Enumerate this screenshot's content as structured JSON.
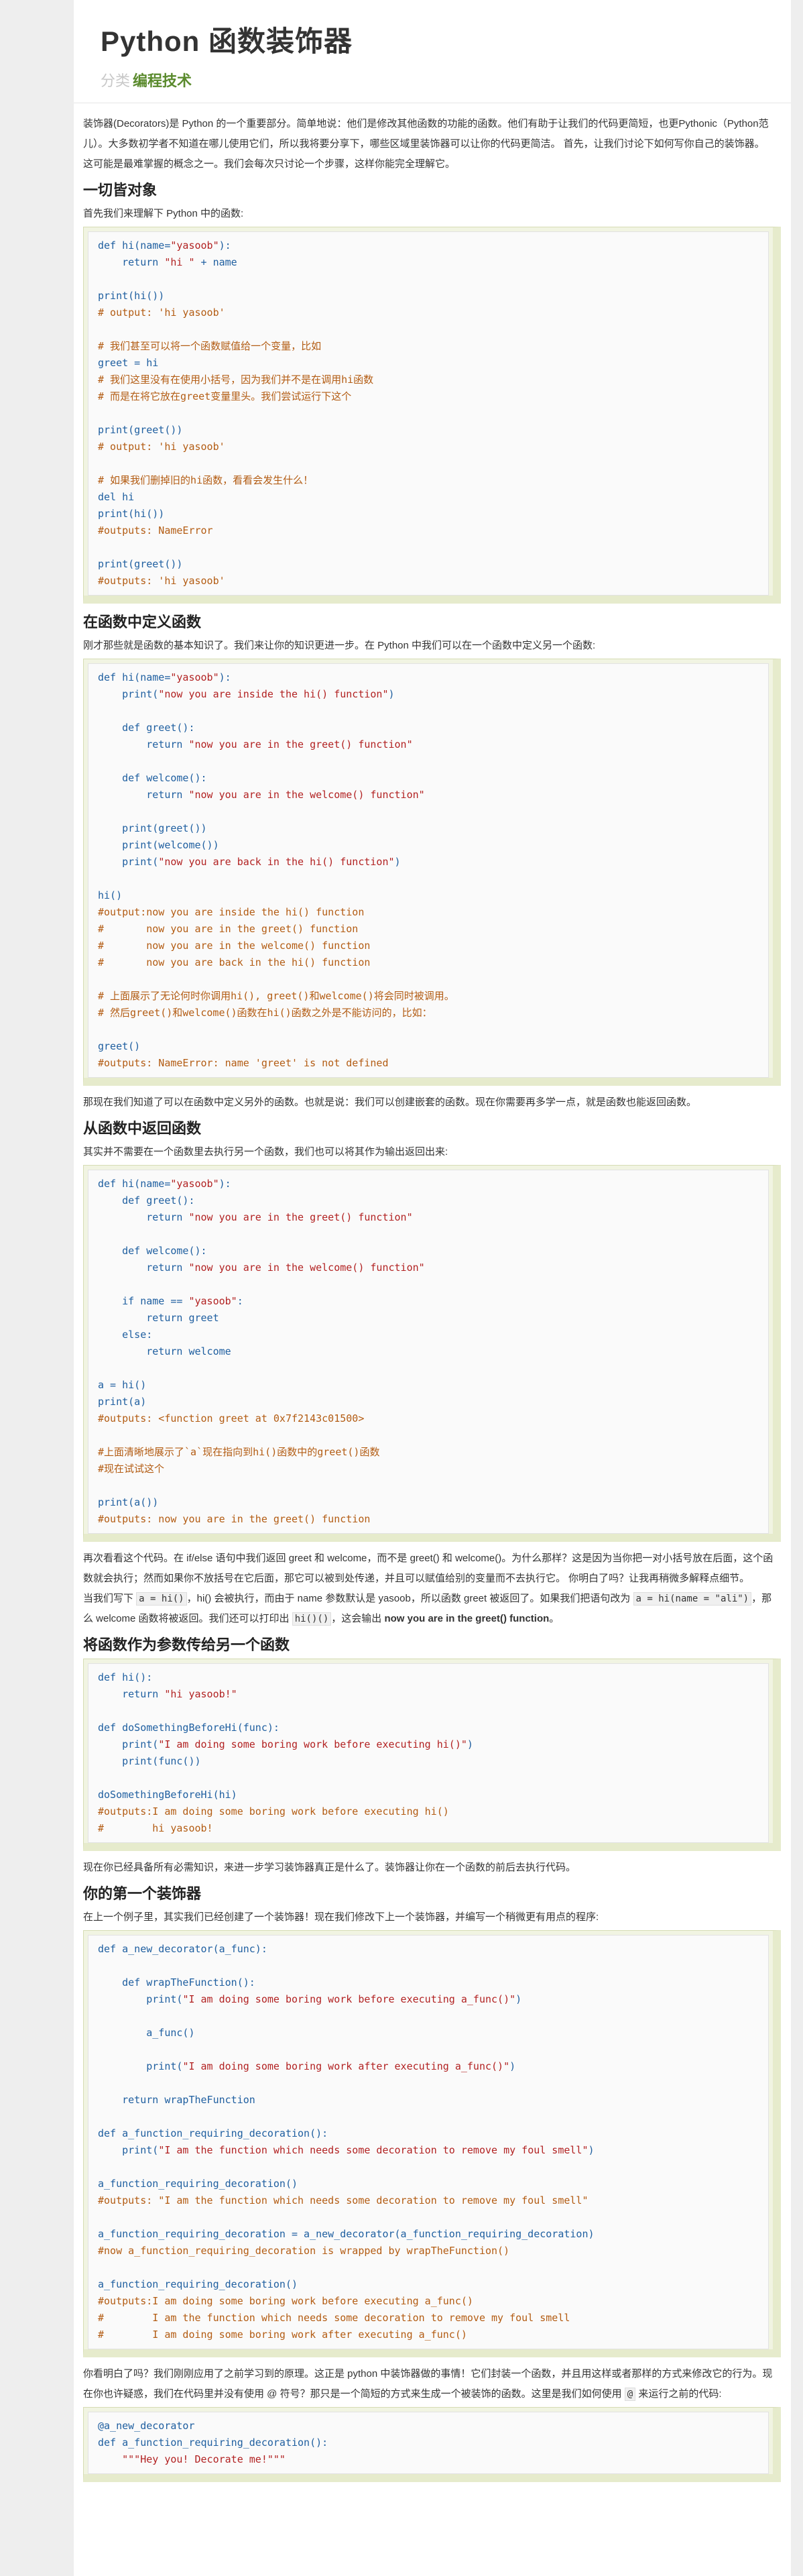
{
  "header": {
    "title": "Python 函数装饰器",
    "category_label": "分类",
    "category_link": "编程技术"
  },
  "intro": [
    "装饰器(Decorators)是 Python 的一个重要部分。简单地说：他们是修改其他函数的功能的函数。他们有助于让我们的代码更简短，也更Pythonic（Python范儿）。大多数初学者不知道在哪儿使用它们，所以我将要分享下，哪些区域里装饰器可以让你的代码更简洁。 首先，让我们讨论下如何写你自己的装饰器。",
    "这可能是最难掌握的概念之一。我们会每次只讨论一个步骤，这样你能完全理解它。"
  ],
  "sections": {
    "s1": {
      "heading": "一切皆对象",
      "text": "首先我们来理解下 Python 中的函数:"
    },
    "s2": {
      "heading": "在函数中定义函数",
      "text": "刚才那些就是函数的基本知识了。我们来让你的知识更进一步。在 Python 中我们可以在一个函数中定义另一个函数:",
      "after": "那现在我们知道了可以在函数中定义另外的函数。也就是说：我们可以创建嵌套的函数。现在你需要再多学一点，就是函数也能返回函数。"
    },
    "s3": {
      "heading": "从函数中返回函数",
      "text": "其实并不需要在一个函数里去执行另一个函数，我们也可以将其作为输出返回出来:",
      "after1": "再次看看这个代码。在 if/else 语句中我们返回 greet 和 welcome，而不是 greet() 和 welcome()。为什么那样？这是因为当你把一对小括号放在后面，这个函数就会执行；然而如果你不放括号在它后面，那它可以被到处传递，并且可以赋值给别的变量而不去执行它。 你明白了吗？让我再稍微多解释点细节。",
      "after2_a": "当我们写下 ",
      "after2_code1": "a = hi()",
      "after2_b": "，hi() 会被执行，而由于 name 参数默认是 yasoob，所以函数 greet 被返回了。如果我们把语句改为 ",
      "after2_code2": "a = hi(name = \"ali\")",
      "after2_c": "，那么 welcome 函数将被返回。我们还可以打印出 ",
      "after2_code3": "hi()()",
      "after2_d": "，这会输出 ",
      "after2_bold": "now you are in the greet() function",
      "after2_e": "。"
    },
    "s4": {
      "heading": "将函数作为参数传给另一个函数",
      "after": "现在你已经具备所有必需知识，来进一步学习装饰器真正是什么了。装饰器让你在一个函数的前后去执行代码。"
    },
    "s5": {
      "heading": "你的第一个装饰器",
      "text": "在上一个例子里，其实我们已经创建了一个装饰器！现在我们修改下上一个装饰器，并编写一个稍微更有用点的程序:",
      "after_a": "你看明白了吗？我们刚刚应用了之前学习到的原理。这正是 python 中装饰器做的事情！它们封装一个函数，并且用这样或者那样的方式来修改它的行为。现在你也许疑惑，我们在代码里并没有使用 @ 符号？那只是一个简短的方式来生成一个被装饰的函数。这里是我们如何使用 ",
      "after_code": "@",
      "after_b": " 来运行之前的代码:"
    }
  },
  "code_blocks": {
    "c1": [
      [
        [
          "k",
          "def hi(name="
        ],
        [
          "s",
          "\"yasoob\""
        ],
        [
          "k",
          "):"
        ]
      ],
      [
        [
          "k",
          "    return "
        ],
        [
          "s",
          "\"hi \""
        ],
        [
          "k",
          " + name"
        ]
      ],
      [
        [
          "k",
          ""
        ]
      ],
      [
        [
          "k",
          "print(hi())"
        ]
      ],
      [
        [
          "c",
          "# output: 'hi yasoob'"
        ]
      ],
      [
        [
          "k",
          ""
        ]
      ],
      [
        [
          "c",
          "# 我们甚至可以将一个函数赋值给一个变量，比如"
        ]
      ],
      [
        [
          "k",
          "greet = hi"
        ]
      ],
      [
        [
          "c",
          "# 我们这里没有在使用小括号，因为我们并不是在调用hi函数"
        ]
      ],
      [
        [
          "c",
          "# 而是在将它放在greet变量里头。我们尝试运行下这个"
        ]
      ],
      [
        [
          "k",
          ""
        ]
      ],
      [
        [
          "k",
          "print(greet())"
        ]
      ],
      [
        [
          "c",
          "# output: 'hi yasoob'"
        ]
      ],
      [
        [
          "k",
          ""
        ]
      ],
      [
        [
          "c",
          "# 如果我们删掉旧的hi函数，看看会发生什么！"
        ]
      ],
      [
        [
          "k",
          "del hi"
        ]
      ],
      [
        [
          "k",
          "print(hi())"
        ]
      ],
      [
        [
          "c",
          "#outputs: NameError"
        ]
      ],
      [
        [
          "k",
          ""
        ]
      ],
      [
        [
          "k",
          "print(greet())"
        ]
      ],
      [
        [
          "c",
          "#outputs: 'hi yasoob'"
        ]
      ]
    ],
    "c2": [
      [
        [
          "k",
          "def hi(name="
        ],
        [
          "s",
          "\"yasoob\""
        ],
        [
          "k",
          "):"
        ]
      ],
      [
        [
          "k",
          "    print("
        ],
        [
          "s",
          "\"now you are inside the hi() function\""
        ],
        [
          "k",
          ")"
        ]
      ],
      [
        [
          "k",
          ""
        ]
      ],
      [
        [
          "k",
          "    def greet():"
        ]
      ],
      [
        [
          "k",
          "        return "
        ],
        [
          "s",
          "\"now you are in the greet() function\""
        ]
      ],
      [
        [
          "k",
          ""
        ]
      ],
      [
        [
          "k",
          "    def welcome():"
        ]
      ],
      [
        [
          "k",
          "        return "
        ],
        [
          "s",
          "\"now you are in the welcome() function\""
        ]
      ],
      [
        [
          "k",
          ""
        ]
      ],
      [
        [
          "k",
          "    print(greet())"
        ]
      ],
      [
        [
          "k",
          "    print(welcome())"
        ]
      ],
      [
        [
          "k",
          "    print("
        ],
        [
          "s",
          "\"now you are back in the hi() function\""
        ],
        [
          "k",
          ")"
        ]
      ],
      [
        [
          "k",
          ""
        ]
      ],
      [
        [
          "k",
          "hi()"
        ]
      ],
      [
        [
          "c",
          "#output:now you are inside the hi() function"
        ]
      ],
      [
        [
          "c",
          "#       now you are in the greet() function"
        ]
      ],
      [
        [
          "c",
          "#       now you are in the welcome() function"
        ]
      ],
      [
        [
          "c",
          "#       now you are back in the hi() function"
        ]
      ],
      [
        [
          "k",
          ""
        ]
      ],
      [
        [
          "c",
          "# 上面展示了无论何时你调用hi(), greet()和welcome()将会同时被调用。"
        ]
      ],
      [
        [
          "c",
          "# 然后greet()和welcome()函数在hi()函数之外是不能访问的，比如："
        ]
      ],
      [
        [
          "k",
          ""
        ]
      ],
      [
        [
          "k",
          "greet()"
        ]
      ],
      [
        [
          "c",
          "#outputs: NameError: name 'greet' is not defined"
        ]
      ]
    ],
    "c3": [
      [
        [
          "k",
          "def hi(name="
        ],
        [
          "s",
          "\"yasoob\""
        ],
        [
          "k",
          "):"
        ]
      ],
      [
        [
          "k",
          "    def greet():"
        ]
      ],
      [
        [
          "k",
          "        return "
        ],
        [
          "s",
          "\"now you are in the greet() function\""
        ]
      ],
      [
        [
          "k",
          ""
        ]
      ],
      [
        [
          "k",
          "    def welcome():"
        ]
      ],
      [
        [
          "k",
          "        return "
        ],
        [
          "s",
          "\"now you are in the welcome() function\""
        ]
      ],
      [
        [
          "k",
          ""
        ]
      ],
      [
        [
          "k",
          "    if name == "
        ],
        [
          "s",
          "\"yasoob\""
        ],
        [
          "k",
          ":"
        ]
      ],
      [
        [
          "k",
          "        return greet"
        ]
      ],
      [
        [
          "k",
          "    else:"
        ]
      ],
      [
        [
          "k",
          "        return welcome"
        ]
      ],
      [
        [
          "k",
          ""
        ]
      ],
      [
        [
          "k",
          "a = hi()"
        ]
      ],
      [
        [
          "k",
          "print(a)"
        ]
      ],
      [
        [
          "c",
          "#outputs: <function greet at 0x7f2143c01500>"
        ]
      ],
      [
        [
          "k",
          ""
        ]
      ],
      [
        [
          "c",
          "#上面清晰地展示了`a`现在指向到hi()函数中的greet()函数"
        ]
      ],
      [
        [
          "c",
          "#现在试试这个"
        ]
      ],
      [
        [
          "k",
          ""
        ]
      ],
      [
        [
          "k",
          "print(a())"
        ]
      ],
      [
        [
          "c",
          "#outputs: now you are in the greet() function"
        ]
      ]
    ],
    "c4": [
      [
        [
          "k",
          "def hi():"
        ]
      ],
      [
        [
          "k",
          "    return "
        ],
        [
          "s",
          "\"hi yasoob!\""
        ]
      ],
      [
        [
          "k",
          ""
        ]
      ],
      [
        [
          "k",
          "def doSomethingBeforeHi(func):"
        ]
      ],
      [
        [
          "k",
          "    print("
        ],
        [
          "s",
          "\"I am doing some boring work before executing hi()\""
        ],
        [
          "k",
          ")"
        ]
      ],
      [
        [
          "k",
          "    print(func())"
        ]
      ],
      [
        [
          "k",
          ""
        ]
      ],
      [
        [
          "k",
          "doSomethingBeforeHi(hi)"
        ]
      ],
      [
        [
          "c",
          "#outputs:I am doing some boring work before executing hi()"
        ]
      ],
      [
        [
          "c",
          "#        hi yasoob!"
        ]
      ]
    ],
    "c5": [
      [
        [
          "k",
          "def a_new_decorator(a_func):"
        ]
      ],
      [
        [
          "k",
          ""
        ]
      ],
      [
        [
          "k",
          "    def wrapTheFunction():"
        ]
      ],
      [
        [
          "k",
          "        print("
        ],
        [
          "s",
          "\"I am doing some boring work before executing a_func()\""
        ],
        [
          "k",
          ")"
        ]
      ],
      [
        [
          "k",
          ""
        ]
      ],
      [
        [
          "k",
          "        a_func()"
        ]
      ],
      [
        [
          "k",
          ""
        ]
      ],
      [
        [
          "k",
          "        print("
        ],
        [
          "s",
          "\"I am doing some boring work after executing a_func()\""
        ],
        [
          "k",
          ")"
        ]
      ],
      [
        [
          "k",
          ""
        ]
      ],
      [
        [
          "k",
          "    return wrapTheFunction"
        ]
      ],
      [
        [
          "k",
          ""
        ]
      ],
      [
        [
          "k",
          "def a_function_requiring_decoration():"
        ]
      ],
      [
        [
          "k",
          "    print("
        ],
        [
          "s",
          "\"I am the function which needs some decoration to remove my foul smell\""
        ],
        [
          "k",
          ")"
        ]
      ],
      [
        [
          "k",
          ""
        ]
      ],
      [
        [
          "k",
          "a_function_requiring_decoration()"
        ]
      ],
      [
        [
          "c",
          "#outputs: \"I am the function which needs some decoration to remove my foul smell\""
        ]
      ],
      [
        [
          "k",
          ""
        ]
      ],
      [
        [
          "k",
          "a_function_requiring_decoration = a_new_decorator(a_function_requiring_decoration)"
        ]
      ],
      [
        [
          "c",
          "#now a_function_requiring_decoration is wrapped by wrapTheFunction()"
        ]
      ],
      [
        [
          "k",
          ""
        ]
      ],
      [
        [
          "k",
          "a_function_requiring_decoration()"
        ]
      ],
      [
        [
          "c",
          "#outputs:I am doing some boring work before executing a_func()"
        ]
      ],
      [
        [
          "c",
          "#        I am the function which needs some decoration to remove my foul smell"
        ]
      ],
      [
        [
          "c",
          "#        I am doing some boring work after executing a_func()"
        ]
      ]
    ],
    "c6": [
      [
        [
          "k",
          "@a_new_decorator"
        ]
      ],
      [
        [
          "k",
          "def a_function_requiring_decoration():"
        ]
      ],
      [
        [
          "k",
          "    "
        ],
        [
          "s",
          "\"\"\"Hey you! Decorate me!\"\"\""
        ]
      ]
    ]
  }
}
